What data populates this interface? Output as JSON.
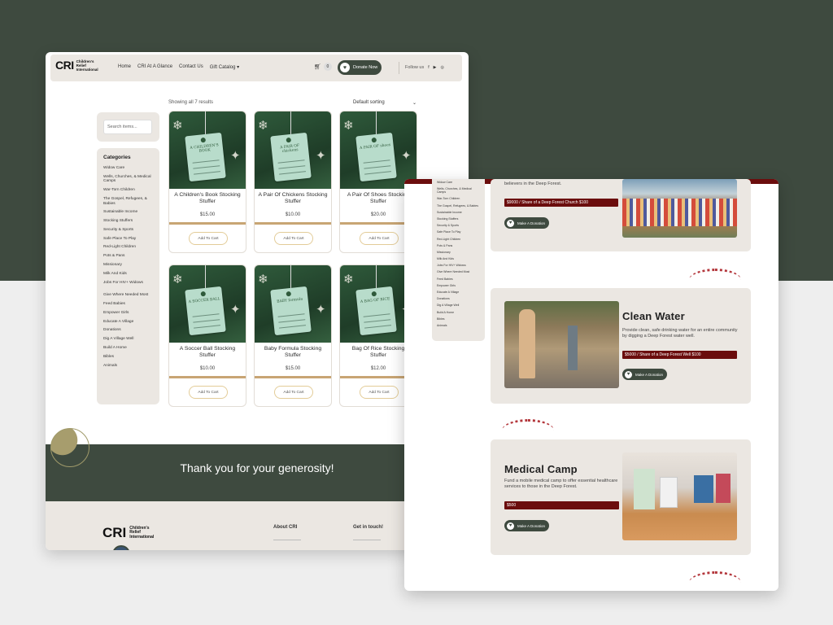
{
  "nav": {
    "logo_mark": "CRI",
    "logo_text": "Children's Relief International",
    "links": [
      "Home",
      "CRI At A Glance",
      "Contact Us",
      "Gift Catalog"
    ],
    "cart_count": "0",
    "donate_label": "Donate Now",
    "follow_label": "Follow us"
  },
  "shop": {
    "showing": "Showing all 7 results",
    "sorting": "Default sorting",
    "search_placeholder": "Search items...",
    "categories_title": "Categories",
    "categories": [
      "Widow Care",
      "Wells, Churches, & Medical Camps",
      "War-Torn Children",
      "The Gospel, Refugees, & Babies",
      "Sustainable Income",
      "Stocking Stuffers",
      "Security & Sports",
      "Safe Place To Play",
      "Red-Light Children",
      "Pots & Pans",
      "Missionary",
      "Milk And Kids",
      "Jobs For HIV+ Widows",
      "Give Where Needed Most",
      "Feed Babies",
      "Empower Girls",
      "Educate A Village",
      "Donations",
      "Dig A Village Well",
      "Build A Home",
      "Bibles",
      "Animals"
    ],
    "products": [
      {
        "name": "A Children's Book Stocking Stuffer",
        "price": "$15.00",
        "tag": "A CHILDREN'S BOOK",
        "button": "Add To Cart"
      },
      {
        "name": "A Pair Of Chickens Stocking Stuffer",
        "price": "$10.00",
        "tag": "A PAIR OF chickens",
        "button": "Add To Cart"
      },
      {
        "name": "A Pair Of Shoes Stocking Stuffer",
        "price": "$20.00",
        "tag": "A PAIR OF shoes",
        "button": "Add To Cart"
      },
      {
        "name": "A Soccer Ball Stocking Stuffer",
        "price": "$10.00",
        "tag": "A SOCCER BALL",
        "button": "Add To Cart"
      },
      {
        "name": "Baby Formula Stocking Stuffer",
        "price": "$15.00",
        "tag": "BABY formula",
        "button": "Add To Cart"
      },
      {
        "name": "Bag Of Rice Stocking Stuffer",
        "price": "$12.00",
        "tag": "A BAG OF RICE",
        "button": "Add To Cart"
      }
    ]
  },
  "thanks": "Thank you for your generosity!",
  "footer": {
    "logo_mark": "CRI",
    "logo_text": "Children's Relief International",
    "about": "About CRI",
    "touch": "Get in touch!"
  },
  "right": {
    "categories": [
      "Widow Care",
      "Wells, Churches, & Medical Camps",
      "War-Torn Children",
      "The Gospel, Refugees, & Babies",
      "Sustainable Income",
      "Stocking Stuffers",
      "Security & Sports",
      "Safe Place To Play",
      "Red-Light Children",
      "Pots & Pans",
      "Missionary",
      "Milk And Kids",
      "Jobs For HIV+ Widows",
      "Give Where Needed Most",
      "Feed Babies",
      "Empower Girls",
      "Educate A Village",
      "Donations",
      "Dig A Village Well",
      "Build A Home",
      "Bibles",
      "Animals"
    ],
    "church": {
      "desc": "believers in the Deep Forest.",
      "price": "$9000 / Share of a Deep Forest Church $100",
      "button": "Make A Donation"
    },
    "water": {
      "title": "Clean Water",
      "desc": "Provide clean, safe drinking water for an entire community by digging a Deep Forest water well.",
      "price": "$5000 / Share of a Deep Forest Well $100",
      "button": "Make A Donation"
    },
    "medical": {
      "title": "Medical Camp",
      "desc": "Fund a mobile medical camp to offer essential healthcare services to those in the Deep Forest.",
      "price": "$500",
      "button": "Make A Donation"
    }
  }
}
